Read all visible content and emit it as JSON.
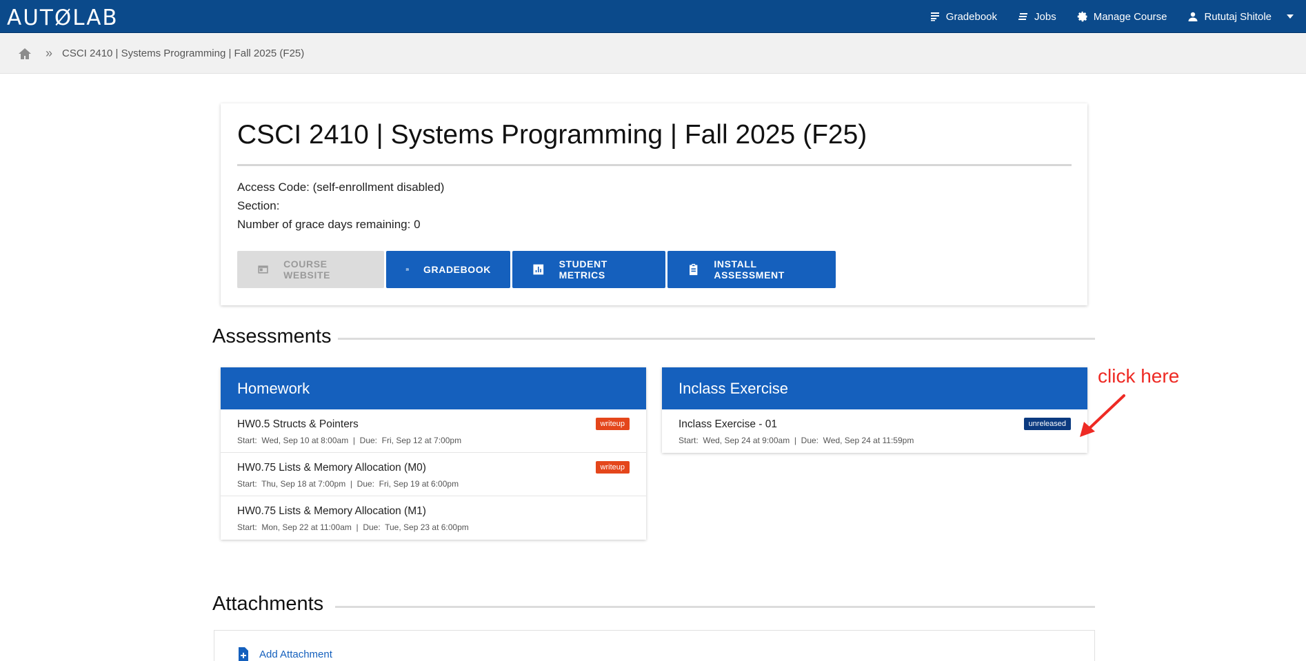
{
  "nav": {
    "logo": "AUTØLAB",
    "links": [
      {
        "label": "Gradebook",
        "icon": "gradebook-icon"
      },
      {
        "label": "Jobs",
        "icon": "jobs-icon"
      },
      {
        "label": "Manage Course",
        "icon": "gear-icon"
      },
      {
        "label": "Rututaj Shitole",
        "icon": "user-icon"
      }
    ]
  },
  "breadcrumb": {
    "home_icon": "home-icon",
    "separator": "»",
    "course": "CSCI 2410 | Systems Programming | Fall 2025 (F25)"
  },
  "course": {
    "title": "CSCI 2410 | Systems Programming | Fall 2025 (F25)",
    "access_code": "Access Code: (self-enrollment disabled)",
    "section": "Section:",
    "grace_days": "Number of grace days remaining: 0",
    "buttons": {
      "course_website": "COURSE WEBSITE",
      "gradebook": "GRADEBOOK",
      "student_metrics": "STUDENT METRICS",
      "install_assessment": "INSTALL ASSESSMENT"
    }
  },
  "assessments": {
    "heading": "Assessments",
    "homework": {
      "title": "Homework",
      "items": [
        {
          "name": "HW0.5 Structs & Pointers",
          "dates": "Start:  Wed, Sep 10 at 8:00am  |  Due:  Fri, Sep 12 at 7:00pm",
          "badge": "writeup"
        },
        {
          "name": "HW0.75 Lists & Memory Allocation (M0)",
          "dates": "Start:  Thu, Sep 18 at 7:00pm  |  Due:  Fri, Sep 19 at 6:00pm",
          "badge": "writeup"
        },
        {
          "name": "HW0.75 Lists & Memory Allocation (M1)",
          "dates": "Start:  Mon, Sep 22 at 11:00am  |  Due:  Tue, Sep 23 at 6:00pm"
        }
      ]
    },
    "inclass": {
      "title": "Inclass Exercise",
      "items": [
        {
          "name": "Inclass Exercise - 01",
          "dates": "Start:  Wed, Sep 24 at 9:00am  |  Due:  Wed, Sep 24 at 11:59pm",
          "badge": "unreleased"
        }
      ]
    }
  },
  "annotation": {
    "text": "click here",
    "color": "#ee2a24"
  },
  "attachments": {
    "heading": "Attachments",
    "add_label": "Add Attachment"
  },
  "colors": {
    "nav_bg": "#0b4a8b",
    "accent": "#1560bd",
    "badge_writeup": "#e4461b",
    "badge_unreleased": "#0b3a80"
  }
}
